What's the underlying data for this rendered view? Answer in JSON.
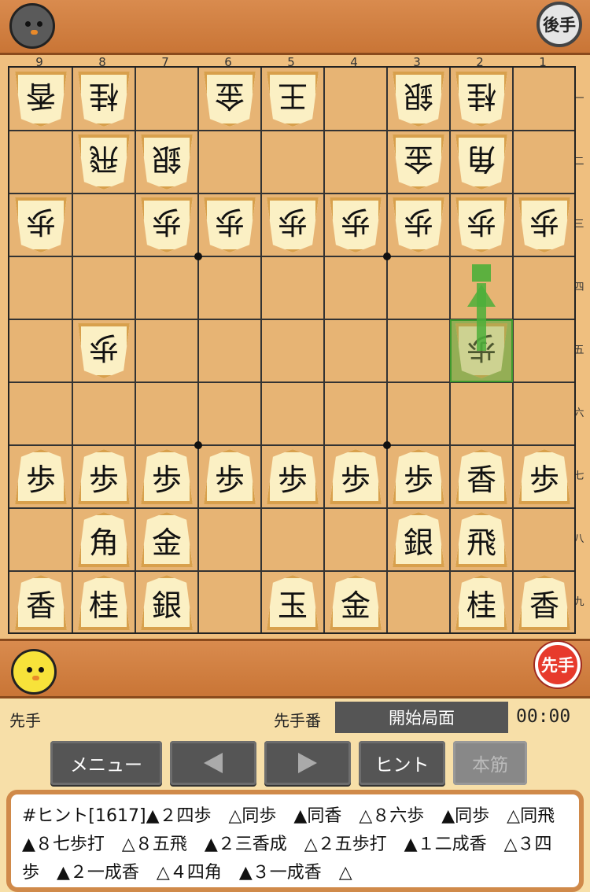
{
  "top_bar": {
    "opponent_avatar": "gray-chick-icon",
    "turn_badge": "後手"
  },
  "bottom_bar": {
    "player_avatar": "yellow-chick-icon",
    "turn_badge": "先手"
  },
  "board": {
    "file_labels": [
      "9",
      "8",
      "7",
      "6",
      "5",
      "4",
      "3",
      "2",
      "1"
    ],
    "rank_labels": [
      "一",
      "二",
      "三",
      "四",
      "五",
      "六",
      "七",
      "八",
      "九"
    ],
    "pieces": [
      {
        "file": 9,
        "rank": 1,
        "glyph": "香",
        "owner": "gote"
      },
      {
        "file": 8,
        "rank": 1,
        "glyph": "桂",
        "owner": "gote"
      },
      {
        "file": 6,
        "rank": 1,
        "glyph": "金",
        "owner": "gote"
      },
      {
        "file": 5,
        "rank": 1,
        "glyph": "王",
        "owner": "gote"
      },
      {
        "file": 3,
        "rank": 1,
        "glyph": "銀",
        "owner": "gote"
      },
      {
        "file": 2,
        "rank": 1,
        "glyph": "桂",
        "owner": "gote"
      },
      {
        "file": 8,
        "rank": 2,
        "glyph": "飛",
        "owner": "gote"
      },
      {
        "file": 7,
        "rank": 2,
        "glyph": "銀",
        "owner": "gote"
      },
      {
        "file": 3,
        "rank": 2,
        "glyph": "金",
        "owner": "gote"
      },
      {
        "file": 2,
        "rank": 2,
        "glyph": "角",
        "owner": "gote"
      },
      {
        "file": 9,
        "rank": 3,
        "glyph": "歩",
        "owner": "gote"
      },
      {
        "file": 7,
        "rank": 3,
        "glyph": "歩",
        "owner": "gote"
      },
      {
        "file": 6,
        "rank": 3,
        "glyph": "歩",
        "owner": "gote"
      },
      {
        "file": 5,
        "rank": 3,
        "glyph": "歩",
        "owner": "gote"
      },
      {
        "file": 4,
        "rank": 3,
        "glyph": "歩",
        "owner": "gote"
      },
      {
        "file": 3,
        "rank": 3,
        "glyph": "歩",
        "owner": "gote"
      },
      {
        "file": 2,
        "rank": 3,
        "glyph": "歩",
        "owner": "gote"
      },
      {
        "file": 1,
        "rank": 3,
        "glyph": "歩",
        "owner": "gote"
      },
      {
        "file": 8,
        "rank": 5,
        "glyph": "歩",
        "owner": "gote"
      },
      {
        "file": 2,
        "rank": 5,
        "glyph": "歩",
        "owner": "gote",
        "faded": true
      },
      {
        "file": 9,
        "rank": 7,
        "glyph": "歩",
        "owner": "sente"
      },
      {
        "file": 8,
        "rank": 7,
        "glyph": "歩",
        "owner": "sente"
      },
      {
        "file": 7,
        "rank": 7,
        "glyph": "歩",
        "owner": "sente"
      },
      {
        "file": 6,
        "rank": 7,
        "glyph": "歩",
        "owner": "sente"
      },
      {
        "file": 5,
        "rank": 7,
        "glyph": "歩",
        "owner": "sente"
      },
      {
        "file": 4,
        "rank": 7,
        "glyph": "歩",
        "owner": "sente"
      },
      {
        "file": 3,
        "rank": 7,
        "glyph": "歩",
        "owner": "sente"
      },
      {
        "file": 2,
        "rank": 7,
        "glyph": "香",
        "owner": "sente"
      },
      {
        "file": 1,
        "rank": 7,
        "glyph": "歩",
        "owner": "sente"
      },
      {
        "file": 8,
        "rank": 8,
        "glyph": "角",
        "owner": "sente"
      },
      {
        "file": 7,
        "rank": 8,
        "glyph": "金",
        "owner": "sente"
      },
      {
        "file": 3,
        "rank": 8,
        "glyph": "銀",
        "owner": "sente"
      },
      {
        "file": 2,
        "rank": 8,
        "glyph": "飛",
        "owner": "sente"
      },
      {
        "file": 9,
        "rank": 9,
        "glyph": "香",
        "owner": "sente"
      },
      {
        "file": 8,
        "rank": 9,
        "glyph": "桂",
        "owner": "sente"
      },
      {
        "file": 7,
        "rank": 9,
        "glyph": "銀",
        "owner": "sente"
      },
      {
        "file": 5,
        "rank": 9,
        "glyph": "玉",
        "owner": "sente"
      },
      {
        "file": 4,
        "rank": 9,
        "glyph": "金",
        "owner": "sente"
      },
      {
        "file": 2,
        "rank": 9,
        "glyph": "桂",
        "owner": "sente"
      },
      {
        "file": 1,
        "rank": 9,
        "glyph": "香",
        "owner": "sente"
      }
    ],
    "hint_move": {
      "from_file": 2,
      "from_rank": 5,
      "to_file": 2,
      "to_rank": 4
    },
    "highlight_color": "#4caf3a"
  },
  "status": {
    "player_label": "先手",
    "turn_label": "先手番",
    "position_label": "開始局面",
    "clock": "00:00"
  },
  "buttons": {
    "menu": "メニュー",
    "prev_icon": "left-triangle-icon",
    "next_icon": "right-triangle-icon",
    "hint": "ヒント",
    "main_line": "本筋"
  },
  "hint_text": "#ヒント[1617]▲２四歩　△同歩　▲同香　△８六歩　▲同歩　△同飛　▲８七歩打　△８五飛　▲２三香成　△２五歩打　▲１二成香　△３四歩　▲２一成香　△４四角　▲３一成香　△"
}
